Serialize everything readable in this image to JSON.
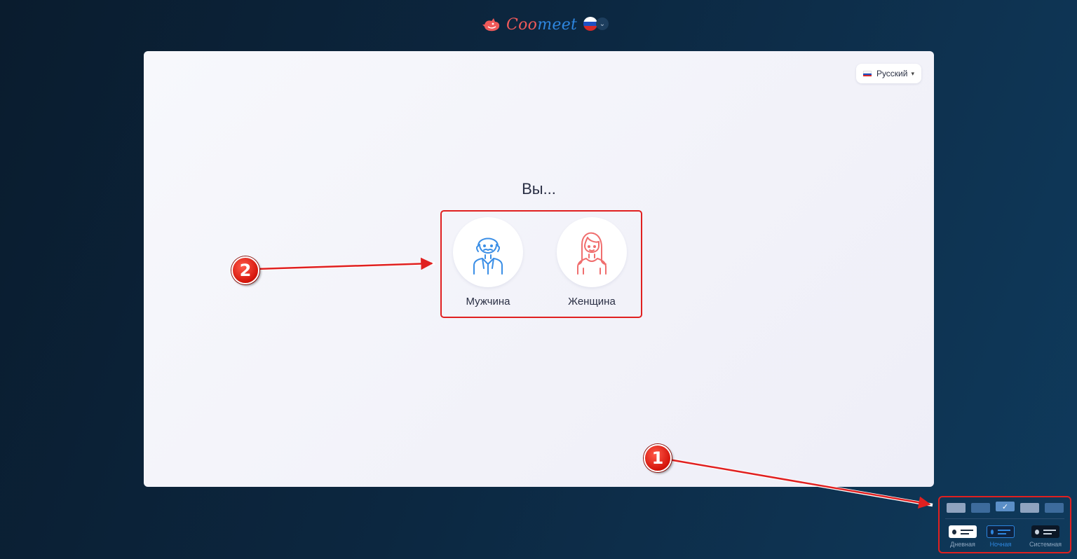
{
  "header": {
    "logo_text_part1": "Coo",
    "logo_text_part2": "meet",
    "lang_flag": "russia-flag"
  },
  "panel": {
    "language_button": "Русский",
    "question": "Вы...",
    "options": [
      {
        "label": "Мужчина",
        "icon": "male-avatar-icon",
        "color": "#3a8ee6"
      },
      {
        "label": "Женщина",
        "icon": "female-avatar-icon",
        "color": "#f06e6e"
      }
    ]
  },
  "theme_switcher": {
    "options": [
      {
        "label": "Дневная",
        "selected": false
      },
      {
        "label": "Ночная",
        "selected": true
      },
      {
        "label": "Системная",
        "selected": false
      }
    ]
  },
  "annotations": [
    {
      "number": "1"
    },
    {
      "number": "2"
    }
  ],
  "colors": {
    "accent_red": "#e02020",
    "brand_coral": "#f05a5a",
    "brand_blue": "#2e86de"
  }
}
